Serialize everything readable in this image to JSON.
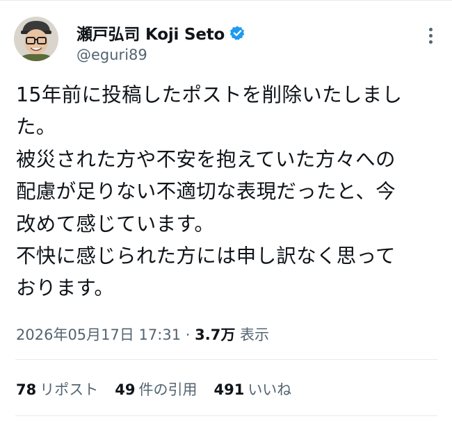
{
  "author": {
    "display_name": "瀬戸弘司 Koji Seto",
    "handle": "@eguri89",
    "verified": true
  },
  "icons": {
    "verified": "verified-badge-icon",
    "more": "more-dots-icon"
  },
  "tweet": {
    "lines": [
      "15年前に投稿したポストを削除いたしまし",
      "た。",
      "被災された方や不安を抱えていた方々への",
      "配慮が足りない不適切な表現だったと、今",
      "改めて感じています。",
      "不快に感じられた方には申し訳なく思って",
      "おります。"
    ]
  },
  "meta": {
    "timestamp": "2026年05月17日 17:31",
    "separator": "·",
    "views_count": "3.7万",
    "views_label": "表示"
  },
  "stats": {
    "reposts_count": "78",
    "reposts_label": "リポスト",
    "quotes_count": "49",
    "quotes_label": "件の引用",
    "likes_count": "491",
    "likes_label": "いいね"
  },
  "colors": {
    "text": "#0f1419",
    "secondary": "#536471",
    "verified_blue": "#1d9bf0",
    "divider": "#e6e9ec"
  }
}
